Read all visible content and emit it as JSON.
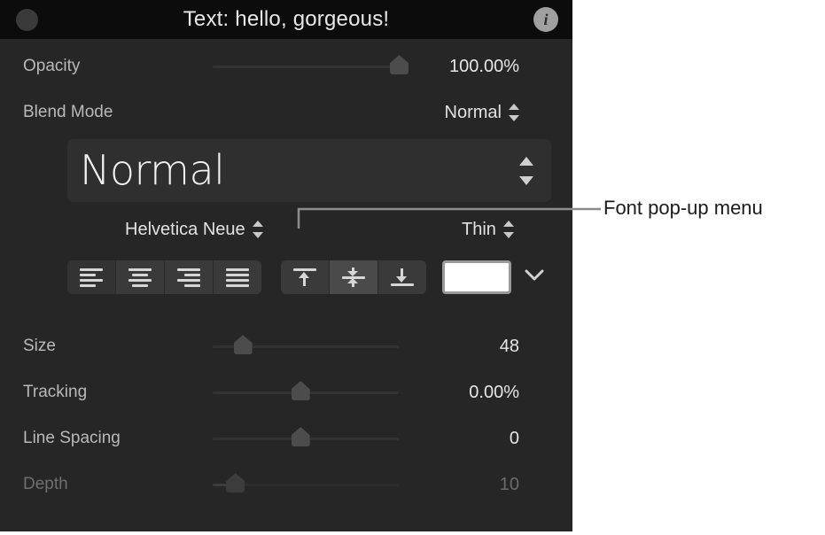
{
  "window": {
    "title": "Text: hello, gorgeous!",
    "close_button": "",
    "info_badge": "i"
  },
  "properties": {
    "opacity": {
      "label": "Opacity",
      "value": "100.00%",
      "slider_percent": 100
    },
    "blend_mode": {
      "label": "Blend Mode",
      "value": "Normal"
    }
  },
  "font": {
    "preview_text": "Normal",
    "family": "Helvetica Neue",
    "typeface": "Thin"
  },
  "alignment": {
    "horizontal": {
      "options": [
        "Align Left",
        "Align Center",
        "Align Right",
        "Justify"
      ],
      "selected_index": 0
    },
    "vertical": {
      "options": [
        "Align Top",
        "Align Middle",
        "Align Bottom"
      ],
      "selected_index": 1
    }
  },
  "color": {
    "swatch_hex": "#FFFFFF",
    "chevron": "chevron-down"
  },
  "sliders": [
    {
      "label": "Size",
      "value": "48",
      "percent": 16,
      "disabled": false
    },
    {
      "label": "Tracking",
      "value": "0.00%",
      "percent": 47,
      "disabled": false
    },
    {
      "label": "Line Spacing",
      "value": "0",
      "percent": 47,
      "disabled": false
    },
    {
      "label": "Depth",
      "value": "10",
      "percent": 12,
      "disabled": true
    }
  ],
  "annotation": {
    "label": "Font pop-up menu"
  },
  "colors": {
    "panel_bg": "#262626",
    "titlebar_bg": "#0C0C0C",
    "text_primary": "#E6E6E6",
    "text_secondary": "#B9B9B9",
    "text_disabled": "#6B6B6B",
    "control_bg": "#3A3A3A",
    "annotation_text": "#1B1B1B"
  }
}
